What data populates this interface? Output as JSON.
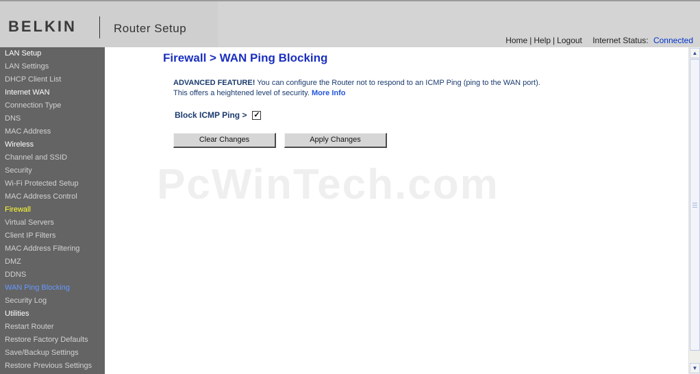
{
  "header": {
    "brand": "BELKIN",
    "app_title": "Router Setup",
    "links": {
      "home": "Home",
      "help": "Help",
      "logout": "Logout",
      "separator": "|"
    },
    "status_label": "Internet Status:",
    "status_value": "Connected",
    "status_color": "#0033cc"
  },
  "sidebar": {
    "items": [
      {
        "label": "LAN Setup",
        "kind": "header"
      },
      {
        "label": "LAN Settings",
        "kind": "link"
      },
      {
        "label": "DHCP Client List",
        "kind": "link"
      },
      {
        "label": "Internet WAN",
        "kind": "header"
      },
      {
        "label": "Connection Type",
        "kind": "link"
      },
      {
        "label": "DNS",
        "kind": "link"
      },
      {
        "label": "MAC Address",
        "kind": "link"
      },
      {
        "label": "Wireless",
        "kind": "header"
      },
      {
        "label": "Channel and SSID",
        "kind": "link"
      },
      {
        "label": "Security",
        "kind": "link"
      },
      {
        "label": "Wi-Fi Protected Setup",
        "kind": "link"
      },
      {
        "label": "MAC Address Control",
        "kind": "link"
      },
      {
        "label": "Firewall",
        "kind": "highlight"
      },
      {
        "label": "Virtual Servers",
        "kind": "link"
      },
      {
        "label": "Client IP Filters",
        "kind": "link"
      },
      {
        "label": "MAC Address Filtering",
        "kind": "link"
      },
      {
        "label": "DMZ",
        "kind": "link"
      },
      {
        "label": "DDNS",
        "kind": "link"
      },
      {
        "label": "WAN Ping Blocking",
        "kind": "active"
      },
      {
        "label": "Security Log",
        "kind": "link"
      },
      {
        "label": "Utilities",
        "kind": "header"
      },
      {
        "label": "Restart Router",
        "kind": "link"
      },
      {
        "label": "Restore Factory Defaults",
        "kind": "link"
      },
      {
        "label": "Save/Backup Settings",
        "kind": "link"
      },
      {
        "label": "Restore Previous Settings",
        "kind": "link"
      }
    ]
  },
  "main": {
    "title": "Firewall > WAN Ping Blocking",
    "desc_strong": "ADVANCED FEATURE!",
    "desc_line1": " You can configure the Router not to respond to an ICMP Ping (ping to the WAN port).",
    "desc_line2": "This offers a heightened level of security.",
    "more_info": "More Info",
    "option_label": "Block ICMP Ping >",
    "option_checked": true,
    "check_glyph": "✓",
    "clear_button": "Clear Changes",
    "apply_button": "Apply Changes",
    "watermark": "PcWinTech.com"
  },
  "icons": {
    "scroll_up": "▲",
    "scroll_down": "▼"
  }
}
